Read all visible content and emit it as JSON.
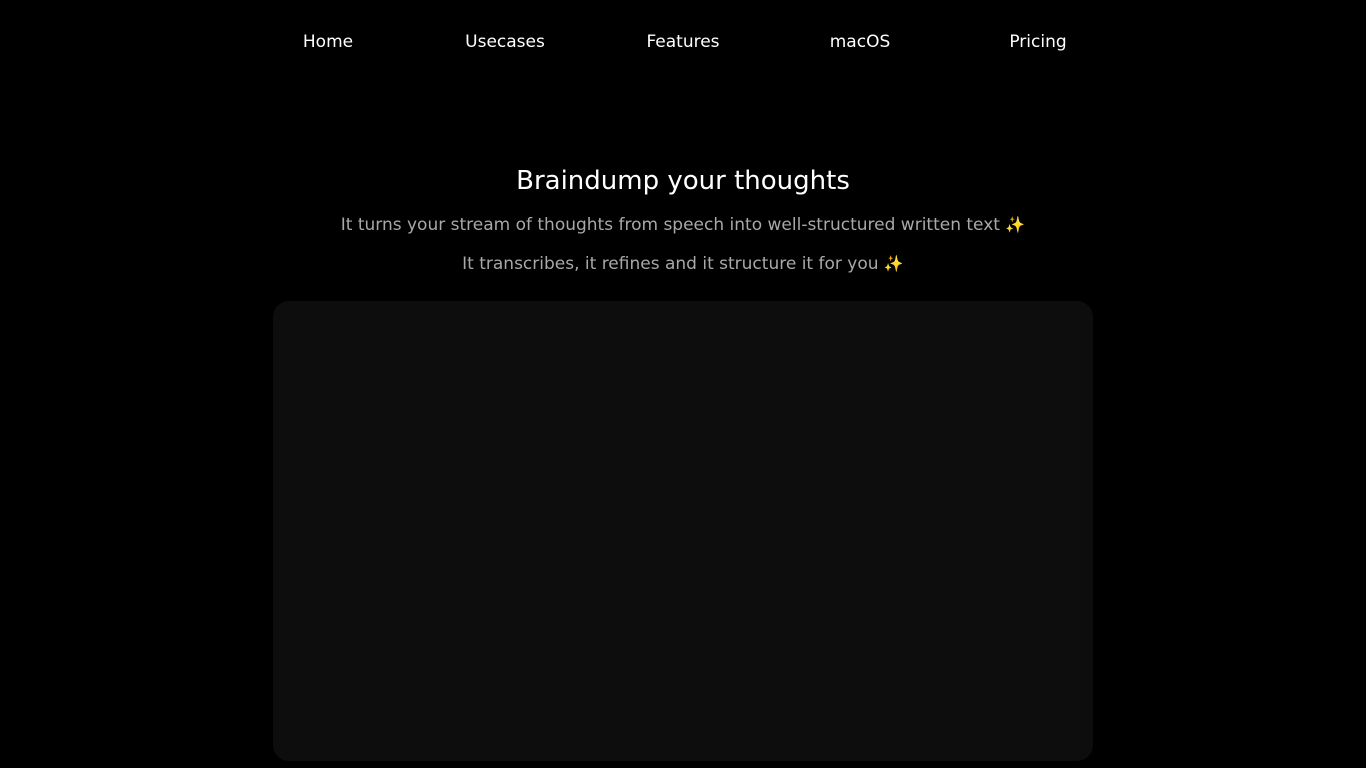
{
  "nav": {
    "items": [
      {
        "label": "Home"
      },
      {
        "label": "Usecases"
      },
      {
        "label": "Features"
      },
      {
        "label": "macOS"
      },
      {
        "label": "Pricing"
      }
    ]
  },
  "hero": {
    "title": "Braindump your thoughts",
    "subtitle_1": "It turns your stream of thoughts from speech into well-structured written text",
    "subtitle_2": "It transcribes, it refines and it structure it for you",
    "sparkle_glyph": "✨"
  },
  "colors": {
    "background": "#000000",
    "text_primary": "#ffffff",
    "text_secondary": "#a8a8a8",
    "panel": "#0d0d0d"
  }
}
